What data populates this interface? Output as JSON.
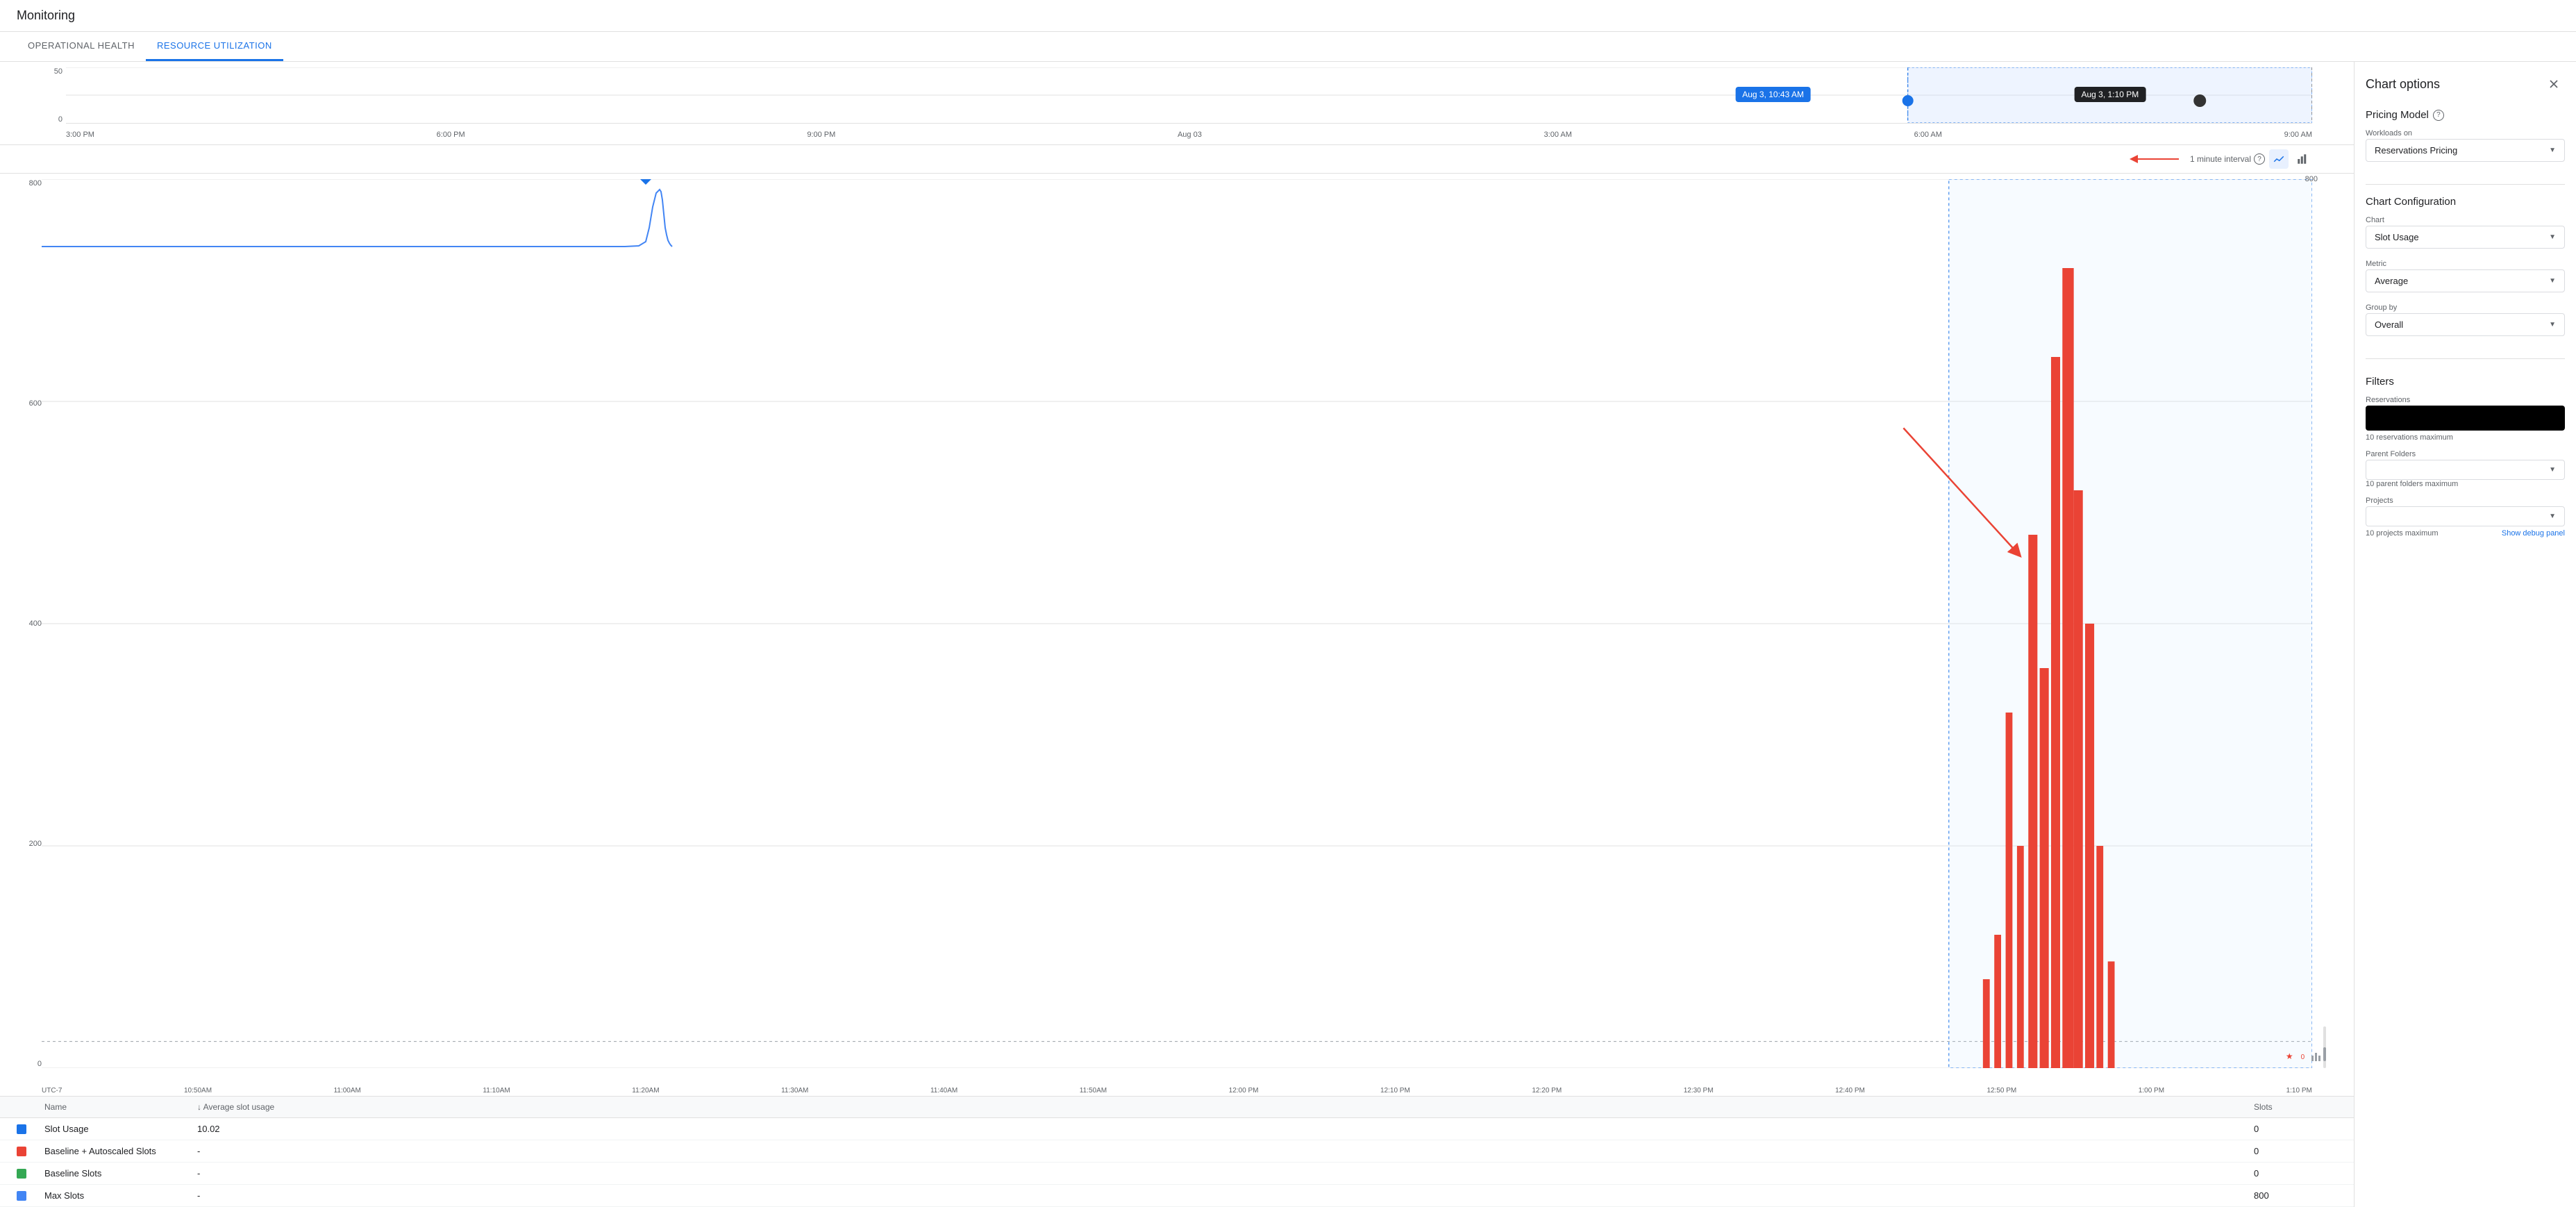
{
  "app": {
    "title": "Monitoring"
  },
  "tabs": [
    {
      "id": "operational-health",
      "label": "OPERATIONAL HEALTH",
      "active": false
    },
    {
      "id": "resource-utilization",
      "label": "RESOURCE UTILIZATION",
      "active": true
    }
  ],
  "miniChart": {
    "yLabels": [
      "50",
      "0"
    ],
    "xLabels": [
      "3:00 PM",
      "6:00 PM",
      "9:00 PM",
      "Aug 03",
      "3:00 AM",
      "6:00 AM",
      "9:00 AM"
    ],
    "tooltip1": "Aug 3, 10:43 AM",
    "tooltip2": "Aug 3, 1:10 PM"
  },
  "intervalBar": {
    "label": "1 minute interval",
    "lineIconLabel": "line chart",
    "barIconLabel": "bar chart"
  },
  "mainChart": {
    "yLabels": [
      "800",
      "600",
      "400",
      "200",
      "0"
    ],
    "xLabels": [
      "UTC-7",
      "10:50AM",
      "11:00AM",
      "11:10AM",
      "11:20AM",
      "11:30AM",
      "11:40AM",
      "11:50AM",
      "12:00 PM",
      "12:10 PM",
      "12:20 PM",
      "12:30 PM",
      "12:40 PM",
      "12:50 PM",
      "1:00 PM",
      "1:10 PM"
    ],
    "selectionStart": "12:50 PM",
    "selectionEnd": "1:10 PM"
  },
  "table": {
    "columns": [
      "",
      "Name",
      "↓ Average slot usage",
      "Slots"
    ],
    "rows": [
      {
        "color": "#1a73e8",
        "name": "Slot Usage",
        "avgSlotUsage": "10.02",
        "slots": "0",
        "colorShape": "square"
      },
      {
        "color": "#ea4335",
        "name": "Baseline + Autoscaled Slots",
        "avgSlotUsage": "-",
        "slots": "0",
        "colorShape": "square"
      },
      {
        "color": "#34a853",
        "name": "Baseline Slots",
        "avgSlotUsage": "-",
        "slots": "0",
        "colorShape": "square"
      },
      {
        "color": "#4285f4",
        "name": "Max Slots",
        "avgSlotUsage": "-",
        "slots": "800",
        "colorShape": "square"
      }
    ]
  },
  "rightPanel": {
    "title": "Chart options",
    "closeLabel": "×",
    "pricingModel": {
      "title": "Pricing Model",
      "helpIcon": "?",
      "workloadsLabel": "Workloads on",
      "workloadsValue": "Reservations Pricing"
    },
    "chartConfig": {
      "title": "Chart Configuration",
      "chartLabel": "Chart",
      "chartValue": "Slot Usage",
      "metricLabel": "Metric",
      "metricValue": "Average",
      "groupByLabel": "Group by",
      "groupByValue": "Overall"
    },
    "filters": {
      "title": "Filters",
      "reservationsLabel": "Reservations",
      "reservationsPlaceholder": "",
      "reservationsHint": "10 reservations maximum",
      "parentFoldersLabel": "Parent Folders",
      "parentFoldersHint": "10 parent folders maximum",
      "projectsLabel": "Projects",
      "projectsHint": "10 projects maximum",
      "debugLabel": "Show debug panel"
    }
  }
}
